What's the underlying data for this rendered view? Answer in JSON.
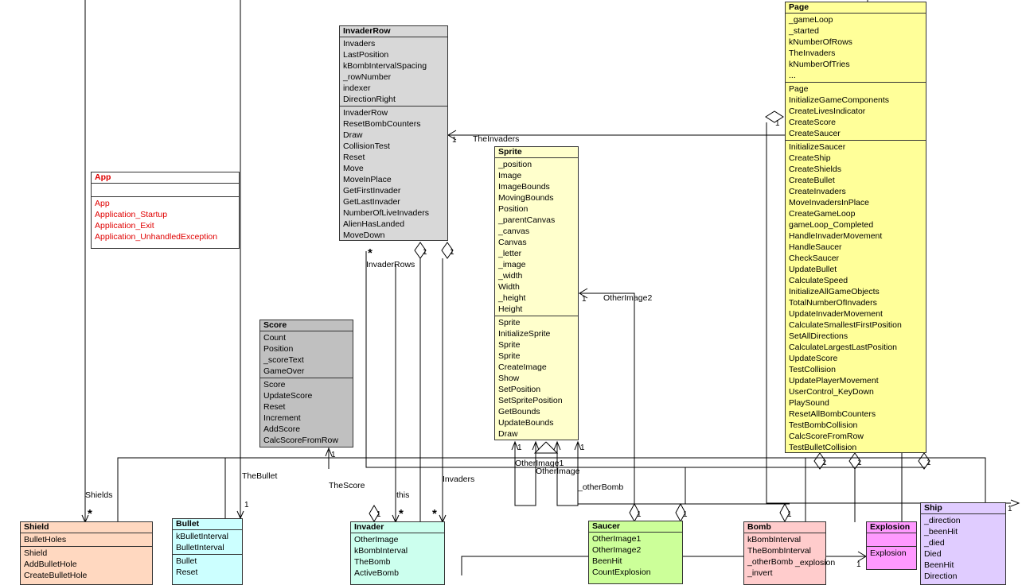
{
  "classes": {
    "invaderrow": {
      "name": "InvaderRow",
      "fields": [
        "Invaders",
        "LastPosition",
        "kBombIntervalSpacing",
        "_rowNumber",
        "indexer",
        "DirectionRight"
      ],
      "methods": [
        "InvaderRow",
        "ResetBombCounters",
        "Draw",
        "CollisionTest",
        "Reset",
        "Move",
        "MoveInPlace",
        "GetFirstInvader",
        "GetLastInvader",
        "NumberOfLiveInvaders",
        "AlienHasLanded",
        "MoveDown"
      ],
      "color": "#d8d8d8"
    },
    "page": {
      "name": "Page",
      "fields": [
        "_gameLoop",
        "_started",
        "kNumberOfRows",
        "TheInvaders",
        "kNumberOfTries",
        "..."
      ],
      "methods": [
        "Page",
        "InitializeGameComponents",
        "CreateLivesIndicator",
        "CreateScore",
        "CreateSaucer"
      ],
      "methods2": [
        "InitializeSaucer",
        "CreateShip",
        "CreateShields",
        "CreateBullet",
        "CreateInvaders",
        "MoveInvadersInPlace",
        "CreateGameLoop",
        "gameLoop_Completed",
        "HandleInvaderMovement",
        "HandleSaucer",
        "CheckSaucer",
        "UpdateBullet",
        "CalculateSpeed",
        "InitializeAllGameObjects",
        "TotalNumberOfInvaders",
        "UpdateInvaderMovement",
        "CalculateSmallestFirstPosition",
        "SetAllDirections",
        "CalculateLargestLastPosition",
        "UpdateScore",
        "TestCollision",
        "UpdatePlayerMovement",
        "UserControl_KeyDown",
        "PlaySound",
        "ResetAllBombCounters",
        "TestBombCollision",
        "CalcScoreFromRow",
        "TestBulletCollision"
      ],
      "color": "#ffff99"
    },
    "sprite": {
      "name": "Sprite",
      "fields": [
        "_position",
        "Image",
        "ImageBounds",
        "MovingBounds",
        "Position",
        "_parentCanvas",
        "_canvas",
        "Canvas",
        "_letter",
        "_image",
        "_width",
        "Width",
        "_height",
        "Height"
      ],
      "methods": [
        "Sprite",
        "InitializeSprite",
        "Sprite",
        "Sprite",
        "CreateImage",
        "Show",
        "SetPosition",
        "SetSpritePosition",
        "GetBounds",
        "UpdateBounds",
        "Draw"
      ],
      "color": "#ffffcc"
    },
    "app": {
      "name": "App",
      "fields": [],
      "methods": [
        "App",
        "Application_Startup",
        "Application_Exit",
        "Application_UnhandledException"
      ],
      "color": "#ffffff",
      "text_color": "#e00000"
    },
    "score": {
      "name": "Score",
      "fields": [
        "Count",
        "Position",
        "_scoreText",
        "GameOver"
      ],
      "methods": [
        "Score",
        "UpdateScore",
        "Reset",
        "Increment",
        "AddScore",
        "CalcScoreFromRow"
      ],
      "color": "#c0c0c0"
    },
    "shield": {
      "name": "Shield",
      "fields": [
        "BulletHoles"
      ],
      "methods": [
        "Shield",
        "AddBulletHole",
        "CreateBulletHole"
      ],
      "color": "#ffd8c0"
    },
    "bullet": {
      "name": "Bullet",
      "fields": [
        "kBulletInterval",
        "BulletInterval"
      ],
      "methods": [
        "Bullet",
        "Reset"
      ],
      "color": "#ccffff"
    },
    "invader": {
      "name": "Invader",
      "fields": [
        "OtherImage",
        "kBombInterval",
        "TheBomb",
        "ActiveBomb"
      ],
      "methods": [],
      "color": "#ccffee"
    },
    "saucer": {
      "name": "Saucer",
      "fields": [
        "OtherImage1",
        "OtherImage2",
        "BeenHit",
        "CountExplosion"
      ],
      "methods": [],
      "color": "#ccff99"
    },
    "bomb": {
      "name": "Bomb",
      "fields": [
        "kBombInterval",
        "TheBombInterval",
        "_otherBomb",
        "_invert"
      ],
      "methods": [],
      "color": "#ffcccc"
    },
    "explosion": {
      "name": "Explosion",
      "fields": [],
      "methods": [
        "Explosion"
      ],
      "color": "#ff99ff"
    },
    "ship": {
      "name": "Ship",
      "fields": [
        "_direction",
        "_beenHit",
        "_died",
        "Died",
        "BeenHit",
        "Direction"
      ],
      "methods": [],
      "color": "#e0ccff"
    }
  },
  "labels": {
    "theinvaders": "TheInvaders",
    "invaderrows": "InvaderRows",
    "otherimage2": "OtherImage2",
    "otherimage1": "OtherImage1",
    "otherimage": "OtherImage",
    "otherbomb": "_otherBomb",
    "shields": "Shields",
    "thebullet": "TheBullet",
    "thescore": "TheScore",
    "this": "this",
    "invaders": "Invaders",
    "explosion": "_explosion"
  },
  "multiplicities": {
    "one": "1",
    "many": "*"
  }
}
